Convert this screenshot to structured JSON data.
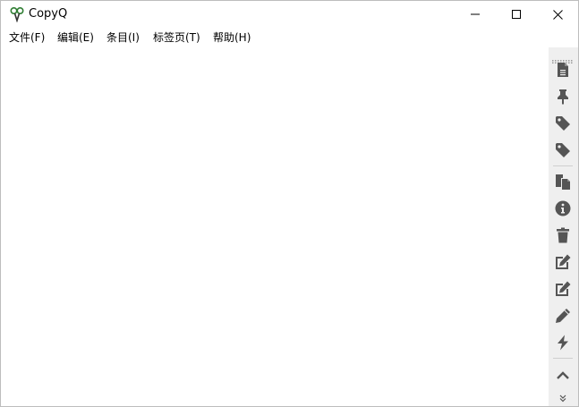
{
  "window": {
    "title": "CopyQ",
    "controls": {
      "minimize": "minimize-icon",
      "maximize": "maximize-icon",
      "close": "close-icon"
    }
  },
  "menu": {
    "items": [
      {
        "label": "文件(F)"
      },
      {
        "label": "编辑(E)"
      },
      {
        "label": "条目(I)"
      },
      {
        "label": "标签页(T)"
      },
      {
        "label": "帮助(H)"
      }
    ]
  },
  "toolbar": {
    "icon_color": "#555555",
    "buttons": [
      {
        "icon": "new-item-icon"
      },
      {
        "icon": "pin-icon"
      },
      {
        "icon": "tag-icon"
      },
      {
        "icon": "tag-icon"
      },
      {
        "icon": "paste-icon"
      },
      {
        "icon": "info-icon"
      },
      {
        "icon": "trash-icon"
      },
      {
        "icon": "edit-icon"
      },
      {
        "icon": "edit-icon"
      },
      {
        "icon": "pencil-icon"
      },
      {
        "icon": "action-icon"
      },
      {
        "icon": "chevron-up-icon"
      },
      {
        "icon": "chevron-double-down-icon"
      }
    ]
  },
  "colors": {
    "background": "#ffffff",
    "toolbar_background": "#efefef",
    "app_icon_green": "#2e7d32"
  }
}
